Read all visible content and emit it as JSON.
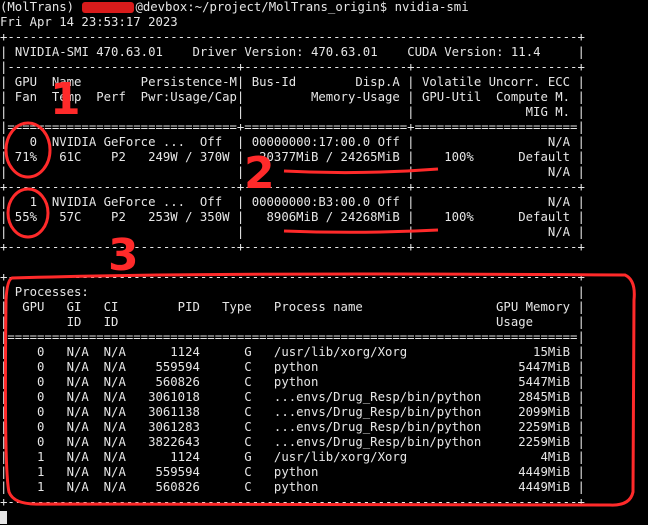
{
  "prompt": {
    "env": "(MolTrans) ",
    "redacted": "user",
    "host": "@devbox:~/project/MolTrans_origin$ ",
    "command": "nvidia-smi"
  },
  "timestamp": "Fri Apr 14 23:53:17 2023",
  "summary": {
    "smi": "NVIDIA-SMI 470.63.01",
    "driver": "Driver Version: 470.63.01",
    "cuda": "CUDA Version: 11.4"
  },
  "gpu_table": {
    "header": [
      "| GPU  Name        Persistence-M| Bus-Id        Disp.A | Volatile Uncorr. ECC |",
      "| Fan  Temp  Perf  Pwr:Usage/Cap|         Memory-Usage | GPU-Util  Compute M. |",
      "|                               |                      |               MIG M. |"
    ],
    "gpus": [
      {
        "row1": "|   0  NVIDIA GeForce ...  Off  | 00000000:17:00.0 Off |                  N/A |",
        "row2": "| 71%   61C    P2   249W / 370W |  20377MiB / 24265MiB |    100%      Default |",
        "row3": "|                               |                      |                  N/A |"
      },
      {
        "row1": "|   1  NVIDIA GeForce ...  Off  | 00000000:B3:00.0 Off |                  N/A |",
        "row2": "| 55%   57C    P2   253W / 350W |   8906MiB / 24268MiB |    100%      Default |",
        "row3": "|                               |                      |                  N/A |"
      }
    ]
  },
  "processes": {
    "title": "| Processes:                                                                  |",
    "header": [
      "|  GPU   GI   CI        PID   Type   Process name                  GPU Memory |",
      "|        ID   ID                                                   Usage      |"
    ],
    "rows": [
      "|    0   N/A  N/A      1124      G   /usr/lib/xorg/Xorg                 15MiB |",
      "|    0   N/A  N/A    559594      C   python                           5447MiB |",
      "|    0   N/A  N/A    560826      C   python                           5447MiB |",
      "|    0   N/A  N/A   3061018      C   ...envs/Drug_Resp/bin/python     2845MiB |",
      "|    0   N/A  N/A   3061138      C   ...envs/Drug_Resp/bin/python     2099MiB |",
      "|    0   N/A  N/A   3061283      C   ...envs/Drug_Resp/bin/python     2259MiB |",
      "|    0   N/A  N/A   3822643      C   ...envs/Drug_Resp/bin/python     2259MiB |",
      "|    1   N/A  N/A      1124      G   /usr/lib/xorg/Xorg                  4MiB |",
      "|    1   N/A  N/A    559594      C   python                           4449MiB |",
      "|    1   N/A  N/A    560826      C   python                           4449MiB |"
    ]
  },
  "annotations": {
    "a1": "1",
    "a2": "2",
    "a3": "3"
  },
  "colors": {
    "annotation": "#ff2a2a",
    "text": "#e6e6e6",
    "background": "#000000"
  }
}
